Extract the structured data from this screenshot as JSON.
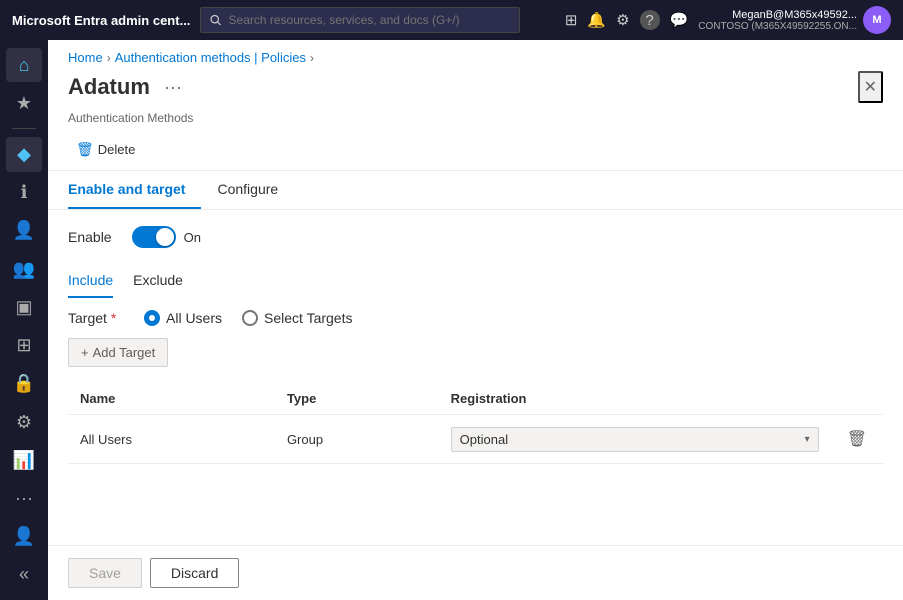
{
  "topbar": {
    "title": "Microsoft Entra admin cent...",
    "search_placeholder": "Search resources, services, and docs (G+/)",
    "user_name": "MeganB@M365x49592...",
    "user_tenant": "CONTOSO (M365X49592255.ON...",
    "icons": {
      "portal": "⊞",
      "bell": "🔔",
      "gear": "⚙",
      "help": "?",
      "feedback": "💬"
    }
  },
  "breadcrumb": {
    "home": "Home",
    "middle": "Authentication methods | Policies",
    "current": "Authentication methods | Policies"
  },
  "page": {
    "title": "Adatum",
    "subtitle": "Authentication Methods",
    "more_icon": "···"
  },
  "toolbar": {
    "delete_label": "Delete"
  },
  "tabs": [
    {
      "id": "enable-target",
      "label": "Enable and target",
      "active": true
    },
    {
      "id": "configure",
      "label": "Configure",
      "active": false
    }
  ],
  "enable_section": {
    "enable_label": "Enable",
    "toggle_state": "On"
  },
  "sub_tabs": [
    {
      "id": "include",
      "label": "Include",
      "active": true
    },
    {
      "id": "exclude",
      "label": "Exclude",
      "active": false
    }
  ],
  "target": {
    "label": "Target",
    "required": "*",
    "options": [
      {
        "id": "all-users",
        "label": "All Users",
        "selected": true
      },
      {
        "id": "select-targets",
        "label": "Select Targets",
        "selected": false
      }
    ]
  },
  "add_target_btn": "+ Add Target",
  "table": {
    "columns": [
      {
        "id": "name",
        "label": "Name"
      },
      {
        "id": "type",
        "label": "Type"
      },
      {
        "id": "registration",
        "label": "Registration"
      }
    ],
    "rows": [
      {
        "name": "All Users",
        "type": "Group",
        "registration": "Optional"
      }
    ]
  },
  "footer": {
    "save_label": "Save",
    "discard_label": "Discard"
  },
  "sidebar": {
    "items": [
      {
        "id": "home",
        "icon": "⌂"
      },
      {
        "id": "favorites",
        "icon": "★"
      },
      {
        "id": "identity",
        "icon": "◆"
      },
      {
        "id": "info",
        "icon": "ℹ"
      },
      {
        "id": "users",
        "icon": "👤"
      },
      {
        "id": "groups",
        "icon": "👥"
      },
      {
        "id": "devices",
        "icon": "▣"
      },
      {
        "id": "apps",
        "icon": "⊞"
      },
      {
        "id": "lock",
        "icon": "🔒"
      },
      {
        "id": "shield",
        "icon": "⚙"
      },
      {
        "id": "reports",
        "icon": "📊"
      },
      {
        "id": "more",
        "icon": "···"
      }
    ]
  }
}
